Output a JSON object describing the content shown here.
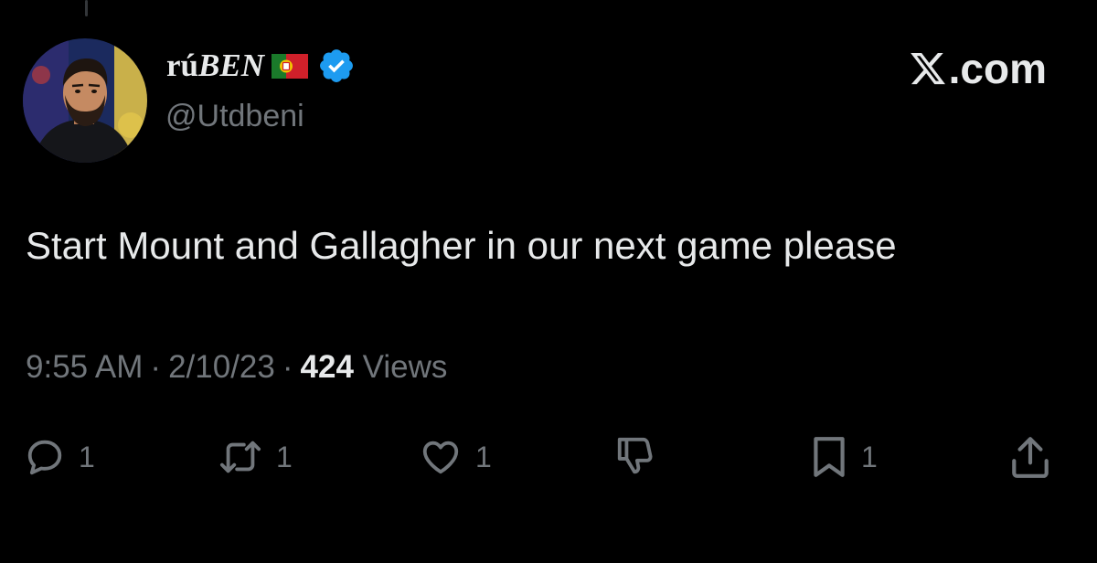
{
  "tweet": {
    "author": {
      "name_prefix": "rú",
      "name_suffix": "BEN",
      "handle": "@Utdbeni",
      "flag": "portugal-flag",
      "verified": true
    },
    "brand": {
      "suffix": ".com"
    },
    "text": "Start Mount and Gallagher in our next game please",
    "meta": {
      "time": "9:55 AM",
      "separator": "·",
      "date": "2/10/23",
      "views_count": "424",
      "views_label": "Views"
    },
    "actions": {
      "reply_count": "1",
      "retweet_count": "1",
      "like_count": "1",
      "bookmark_count": "1"
    }
  },
  "colors": {
    "background": "#000000",
    "primary_text": "#e7e9ea",
    "secondary_text": "#71767b",
    "verified_blue": "#1d9bf0"
  }
}
